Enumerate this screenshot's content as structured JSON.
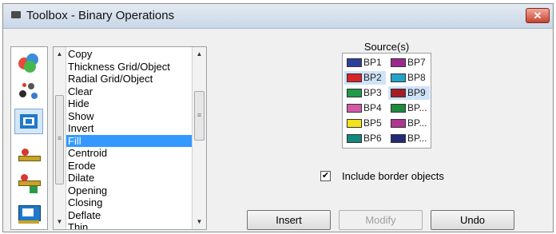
{
  "window": {
    "title": "Toolbox - Binary Operations",
    "close_glyph": "✕"
  },
  "tool_icons": [
    {
      "name": "color-blobs-icon"
    },
    {
      "name": "molecule-icon"
    },
    {
      "name": "selection-square-icon",
      "selected": true
    },
    {
      "name": "layer-red-icon"
    },
    {
      "name": "layer-add-icon"
    },
    {
      "name": "layer-blue-icon"
    }
  ],
  "operations": {
    "items": [
      "Copy",
      "Thickness Grid/Object",
      "Radial Grid/Object",
      "Clear",
      "Hide",
      "Show",
      "Invert",
      "Fill",
      "Centroid",
      "Erode",
      "Dilate",
      "Opening",
      "Closing",
      "Deflate",
      "Thin"
    ],
    "selected": "Fill"
  },
  "sources": {
    "label": "Source(s)",
    "items": [
      {
        "label": "BP1",
        "color": "#2d3e9a"
      },
      {
        "label": "BP7",
        "color": "#9c2a8e"
      },
      {
        "label": "BP2",
        "color": "#d8232a",
        "selected": true
      },
      {
        "label": "BP8",
        "color": "#22a4c9"
      },
      {
        "label": "BP3",
        "color": "#1e9a4a"
      },
      {
        "label": "BP9",
        "color": "#a51d24",
        "selected": true
      },
      {
        "label": "BP4",
        "color": "#d45aa8"
      },
      {
        "label": "BP...",
        "color": "#1e8a3e"
      },
      {
        "label": "BP5",
        "color": "#f2e21a"
      },
      {
        "label": "BP...",
        "color": "#b0358f"
      },
      {
        "label": "BP6",
        "color": "#12897f"
      },
      {
        "label": "BP...",
        "color": "#242a78"
      }
    ]
  },
  "include_border": {
    "label": "Include border objects",
    "checked": true,
    "check_glyph": "✔"
  },
  "buttons": {
    "insert": "Insert",
    "modify": "Modify",
    "undo": "Undo"
  }
}
